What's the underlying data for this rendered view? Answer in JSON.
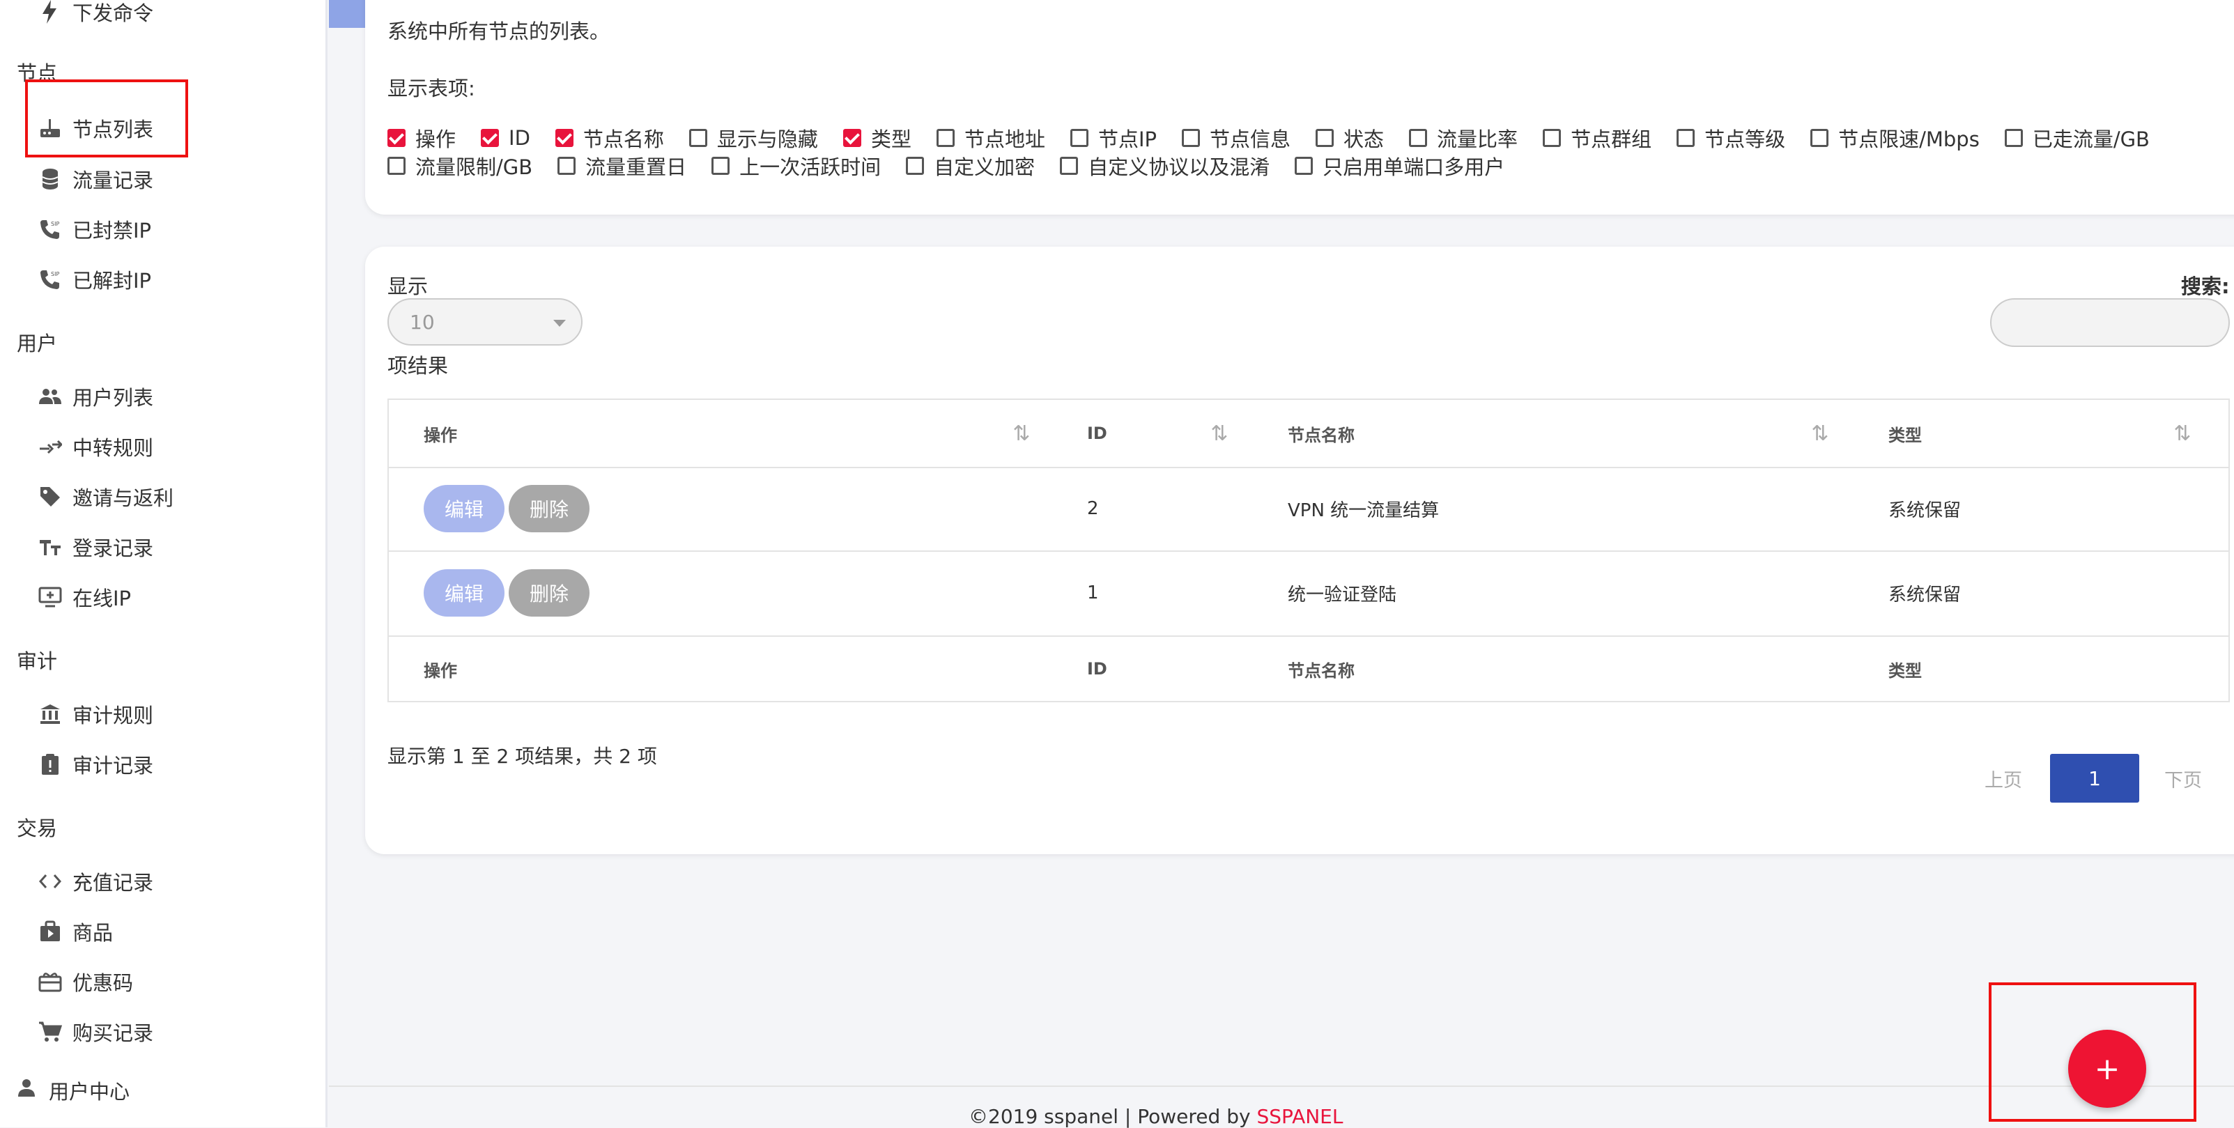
{
  "sidebar": {
    "top_item": {
      "label": "下发命令",
      "icon": "lightning-icon"
    },
    "sections": [
      {
        "title": "节点",
        "items": [
          {
            "label": "节点列表",
            "icon": "router-icon"
          },
          {
            "label": "流量记录",
            "icon": "database-icon"
          },
          {
            "label": "已封禁IP",
            "icon": "phone-sip-icon"
          },
          {
            "label": "已解封IP",
            "icon": "phone-sip-icon"
          }
        ]
      },
      {
        "title": "用户",
        "items": [
          {
            "label": "用户列表",
            "icon": "users-icon"
          },
          {
            "label": "中转规则",
            "icon": "relay-icon"
          },
          {
            "label": "邀请与返利",
            "icon": "tag-icon"
          },
          {
            "label": "登录记录",
            "icon": "text-icon"
          },
          {
            "label": "在线IP",
            "icon": "monitor-add-icon"
          }
        ]
      },
      {
        "title": "审计",
        "items": [
          {
            "label": "审计规则",
            "icon": "bank-icon"
          },
          {
            "label": "审计记录",
            "icon": "clipboard-alert-icon"
          }
        ]
      },
      {
        "title": "交易",
        "items": [
          {
            "label": "充值记录",
            "icon": "code-icon"
          },
          {
            "label": "商品",
            "icon": "shop-icon"
          },
          {
            "label": "优惠码",
            "icon": "gift-card-icon"
          },
          {
            "label": "购买记录",
            "icon": "cart-icon"
          }
        ]
      }
    ],
    "user_center": {
      "label": "用户中心",
      "icon": "person-icon"
    }
  },
  "main": {
    "description": "系统中所有节点的列表。",
    "columns_label": "显示表项:",
    "column_toggles": [
      {
        "label": "操作",
        "checked": true
      },
      {
        "label": "ID",
        "checked": true
      },
      {
        "label": "节点名称",
        "checked": true
      },
      {
        "label": "显示与隐藏",
        "checked": false
      },
      {
        "label": "类型",
        "checked": true
      },
      {
        "label": "节点地址",
        "checked": false
      },
      {
        "label": "节点IP",
        "checked": false
      },
      {
        "label": "节点信息",
        "checked": false
      },
      {
        "label": "状态",
        "checked": false
      },
      {
        "label": "流量比率",
        "checked": false
      },
      {
        "label": "节点群组",
        "checked": false
      },
      {
        "label": "节点等级",
        "checked": false
      },
      {
        "label": "节点限速/Mbps",
        "checked": false
      },
      {
        "label": "已走流量/GB",
        "checked": false
      },
      {
        "label": "流量限制/GB",
        "checked": false
      },
      {
        "label": "流量重置日",
        "checked": false
      },
      {
        "label": "上一次活跃时间",
        "checked": false
      },
      {
        "label": "自定义加密",
        "checked": false
      },
      {
        "label": "自定义协议以及混淆",
        "checked": false
      },
      {
        "label": "只启用单端口多用户",
        "checked": false
      }
    ],
    "length": {
      "label": "显示",
      "value": "10",
      "suffix": "项结果"
    },
    "search": {
      "label": "搜索:",
      "value": ""
    },
    "table": {
      "headers": [
        "操作",
        "ID",
        "节点名称",
        "类型"
      ],
      "rows": [
        {
          "id": "2",
          "name": "VPN 统一流量结算",
          "type": "系统保留"
        },
        {
          "id": "1",
          "name": "统一验证登陆",
          "type": "系统保留"
        }
      ],
      "edit_label": "编辑",
      "delete_label": "删除"
    },
    "info": "显示第 1 至 2 项结果，共 2 项",
    "pagination": {
      "prev": "上页",
      "current": "1",
      "next": "下页"
    }
  },
  "footer": {
    "text": "©2019 sspanel | Powered by ",
    "brand": "SSPANEL"
  },
  "fab": {
    "label": "+"
  },
  "colors": {
    "accent": "#e8143c",
    "primary": "#2f4fb0",
    "edit": "#a9b7ee"
  }
}
